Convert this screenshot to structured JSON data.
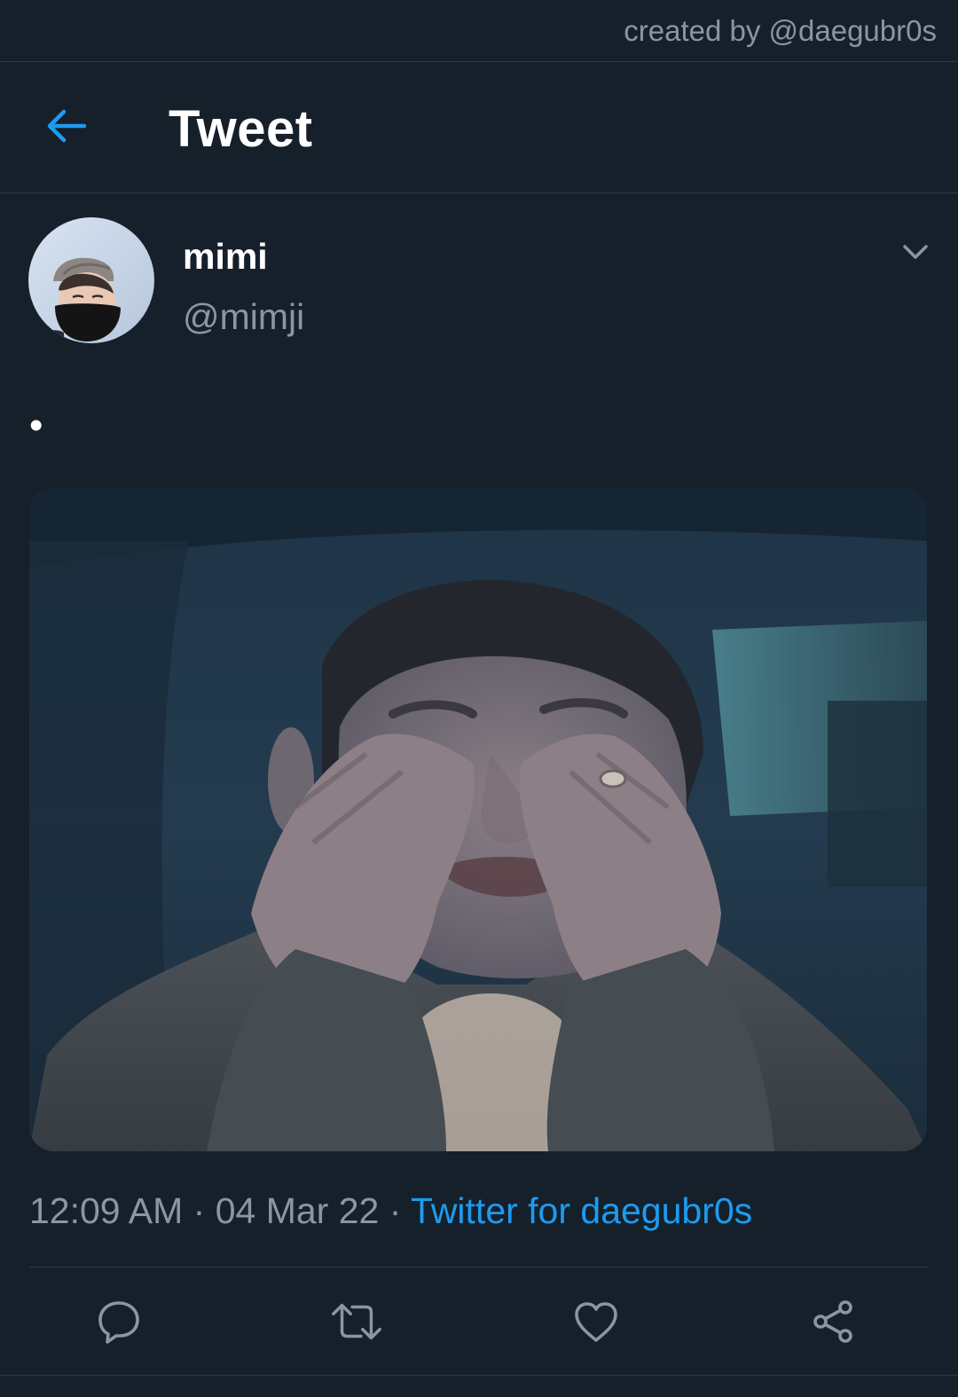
{
  "credit": "created by @daegubr0s",
  "header": {
    "back_icon": "arrow-left-icon",
    "title": "Tweet"
  },
  "author": {
    "display_name": "mimi",
    "handle": "@mimji",
    "avatar_icon": "avatar"
  },
  "more_icon": "chevron-down-icon",
  "tweet": {
    "text": "•"
  },
  "meta": {
    "time": "12:09 AM",
    "separator": "·",
    "date": "04 Mar 22",
    "source": "Twitter for daegubr0s"
  },
  "actions": [
    {
      "icon": "reply-icon"
    },
    {
      "icon": "retweet-icon"
    },
    {
      "icon": "like-icon"
    },
    {
      "icon": "share-icon"
    }
  ],
  "colors": {
    "background": "#15202b",
    "accent": "#1d9bf0",
    "secondary_text": "#8a96a3",
    "divider": "#2f3b47"
  }
}
